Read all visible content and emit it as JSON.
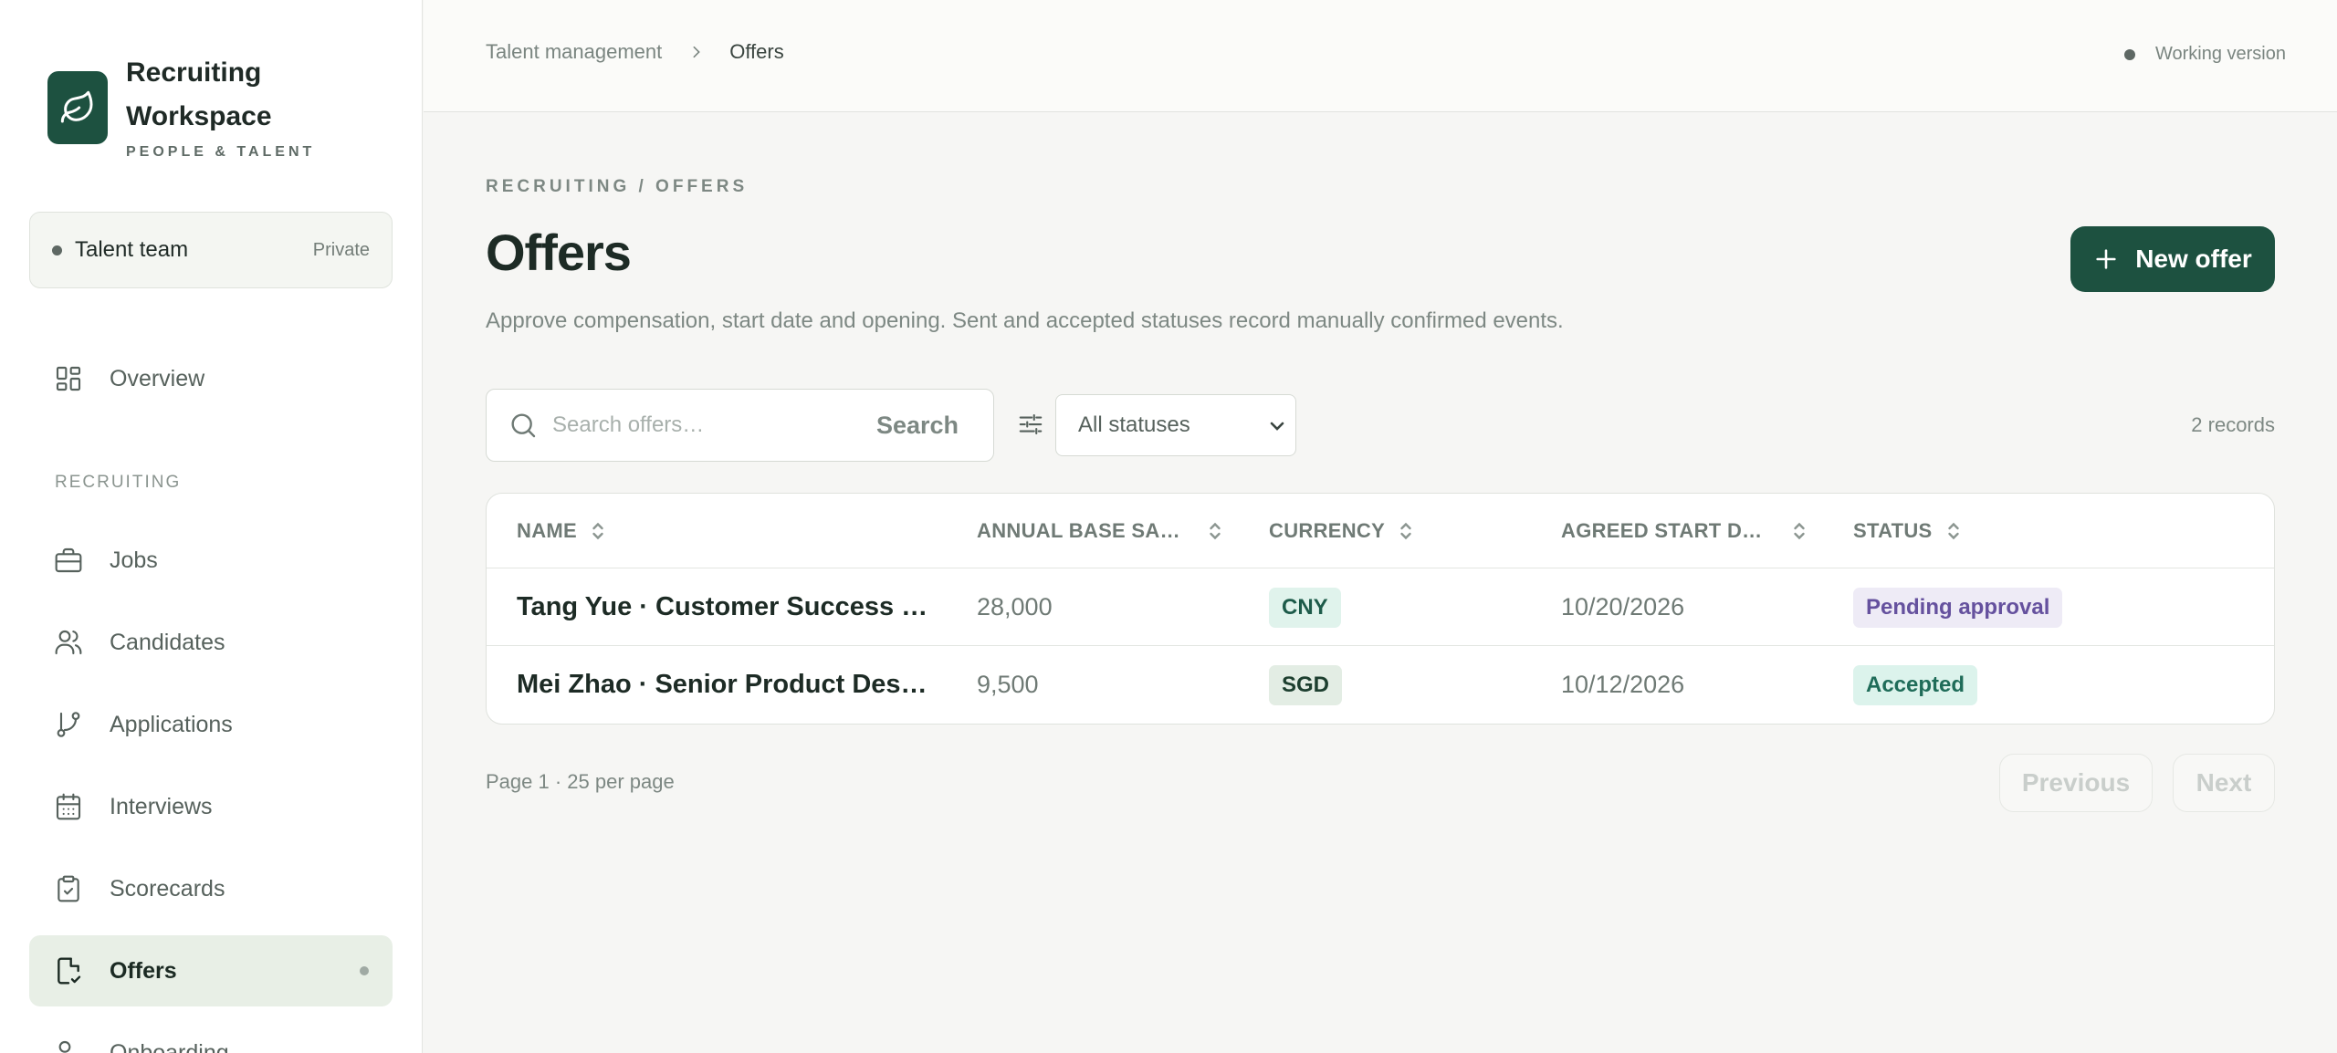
{
  "brand": {
    "title": "Recruiting Workspace",
    "subtitle": "PEOPLE & TALENT"
  },
  "team": {
    "name": "Talent team",
    "visibility": "Private"
  },
  "nav": {
    "overview": "Overview",
    "section_label": "RECRUITING",
    "items": [
      {
        "label": "Jobs",
        "icon": "briefcase-icon"
      },
      {
        "label": "Candidates",
        "icon": "users-icon"
      },
      {
        "label": "Applications",
        "icon": "git-branch-icon"
      },
      {
        "label": "Interviews",
        "icon": "calendar-icon"
      },
      {
        "label": "Scorecards",
        "icon": "clipboard-check-icon"
      },
      {
        "label": "Offers",
        "icon": "file-check-icon",
        "active": true
      },
      {
        "label": "Onboarding",
        "icon": "user-check-icon"
      }
    ]
  },
  "topbar": {
    "breadcrumb_parent": "Talent management",
    "breadcrumb_current": "Offers",
    "version": "Working version"
  },
  "header": {
    "eyebrow": "RECRUITING / OFFERS",
    "title": "Offers",
    "description": "Approve compensation, start date and opening. Sent and accepted statuses record manually confirmed events.",
    "new_button": "New offer"
  },
  "toolbar": {
    "search_placeholder": "Search offers…",
    "search_button": "Search",
    "status_filter": "All statuses",
    "record_count": "2 records"
  },
  "table": {
    "columns": [
      "NAME",
      "ANNUAL BASE SA…",
      "CURRENCY",
      "AGREED START D…",
      "STATUS"
    ],
    "rows": [
      {
        "name": "Tang Yue · Customer Success …",
        "salary": "28,000",
        "currency": "CNY",
        "start": "10/20/2026",
        "status": "Pending approval"
      },
      {
        "name": "Mei Zhao · Senior Product Des…",
        "salary": "9,500",
        "currency": "SGD",
        "start": "10/12/2026",
        "status": "Accepted"
      }
    ]
  },
  "pagination": {
    "info": "Page 1 · 25 per page",
    "previous": "Previous",
    "next": "Next"
  },
  "colors": {
    "brand_green": "#1d5140",
    "active_nav_bg": "#e8efe6",
    "pending_pill": "#65519e",
    "accepted_pill": "#1f6c59"
  }
}
